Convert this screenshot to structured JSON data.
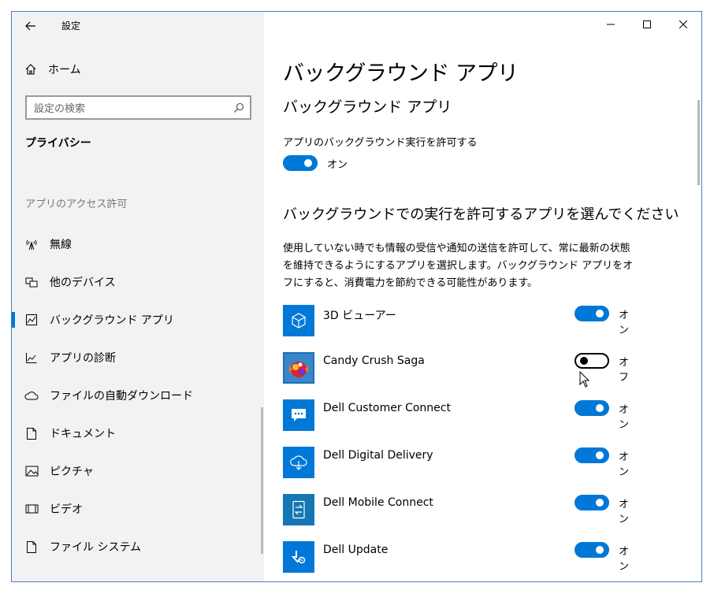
{
  "titlebar": {
    "title": "設定"
  },
  "sidebar": {
    "home_label": "ホーム",
    "search_placeholder": "設定の検索",
    "section": "プライバシー",
    "group": "アプリのアクセス許可",
    "items": [
      {
        "label": "無線",
        "icon": "radio-tower-icon"
      },
      {
        "label": "他のデバイス",
        "icon": "devices-icon"
      },
      {
        "label": "バックグラウンド アプリ",
        "icon": "background-apps-icon",
        "active": true
      },
      {
        "label": "アプリの診断",
        "icon": "diagnostics-icon"
      },
      {
        "label": "ファイルの自動ダウンロード",
        "icon": "cloud-icon"
      },
      {
        "label": "ドキュメント",
        "icon": "document-icon"
      },
      {
        "label": "ピクチャ",
        "icon": "picture-icon"
      },
      {
        "label": "ビデオ",
        "icon": "video-icon"
      },
      {
        "label": "ファイル システム",
        "icon": "file-icon"
      }
    ]
  },
  "main": {
    "page_title": "バックグラウンド アプリ",
    "sub_title": "バックグラウンド アプリ",
    "allow_label": "アプリのバックグラウンド実行を許可する",
    "allow_state": "オン",
    "choose_title": "バックグラウンドでの実行を許可するアプリを選んでください",
    "description": "使用していない時でも情報の受信や通知の送信を許可して、常に最新の状態を維持できるようにするアプリを選択します。バックグラウンド アプリをオフにすると、消費電力を節約できる可能性があります。",
    "apps": [
      {
        "name": "3D ビューアー",
        "state": "オン",
        "on": true,
        "icon": "cube-icon"
      },
      {
        "name": "Candy Crush Saga",
        "state": "オフ",
        "on": false,
        "icon": "candy-icon"
      },
      {
        "name": "Dell Customer Connect",
        "state": "オン",
        "on": true,
        "icon": "chat-icon"
      },
      {
        "name": "Dell Digital Delivery",
        "state": "オン",
        "on": true,
        "icon": "cloud-download-icon"
      },
      {
        "name": "Dell Mobile Connect",
        "state": "オン",
        "on": true,
        "icon": "mobile-connect-icon"
      },
      {
        "name": "Dell Update",
        "state": "オン",
        "on": true,
        "icon": "update-icon"
      }
    ]
  },
  "colors": {
    "accent": "#0078d7",
    "sidebar_bg": "#f2f2f2"
  }
}
